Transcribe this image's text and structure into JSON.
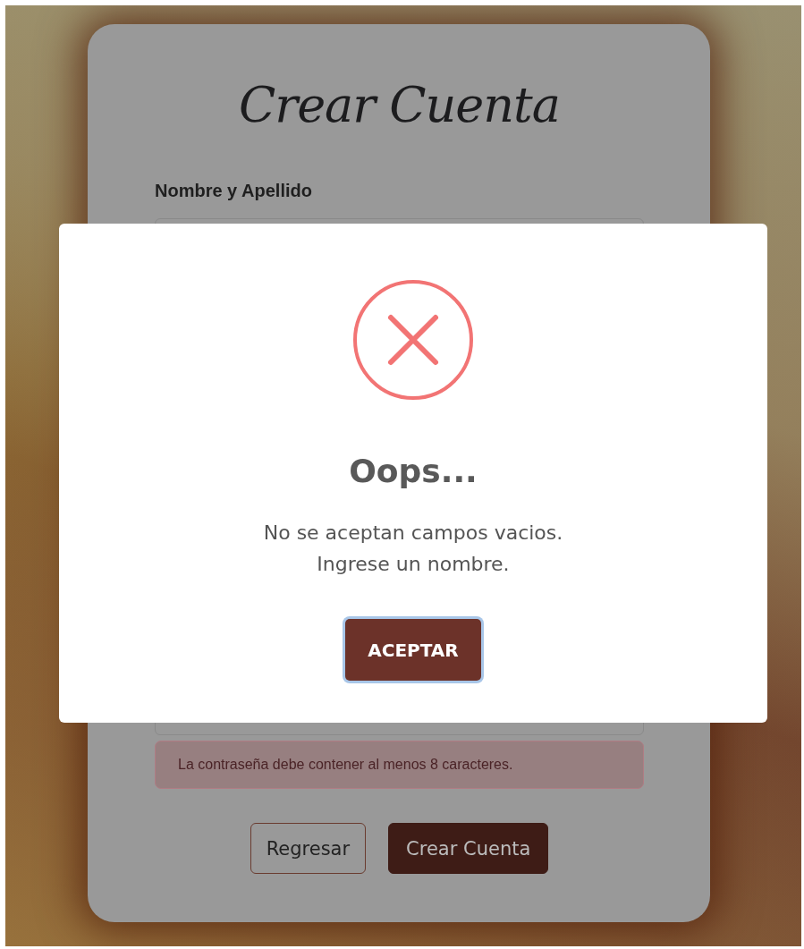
{
  "form": {
    "title": "Crear Cuenta",
    "name_label": "Nombre y Apellido",
    "alert": "La contraseña debe contener al menos 8 caracteres.",
    "buttons": [
      {
        "label": "Regresar",
        "kind": "outline"
      },
      {
        "label": "Crear Cuenta",
        "kind": "primary"
      }
    ]
  },
  "dialog": {
    "icon": {
      "kind": "error"
    },
    "title": "Oops...",
    "message": "No se aceptan campos vacios.\nIngrese un nombre.",
    "button": {
      "label": "ACEPTAR",
      "focused": true
    }
  }
}
